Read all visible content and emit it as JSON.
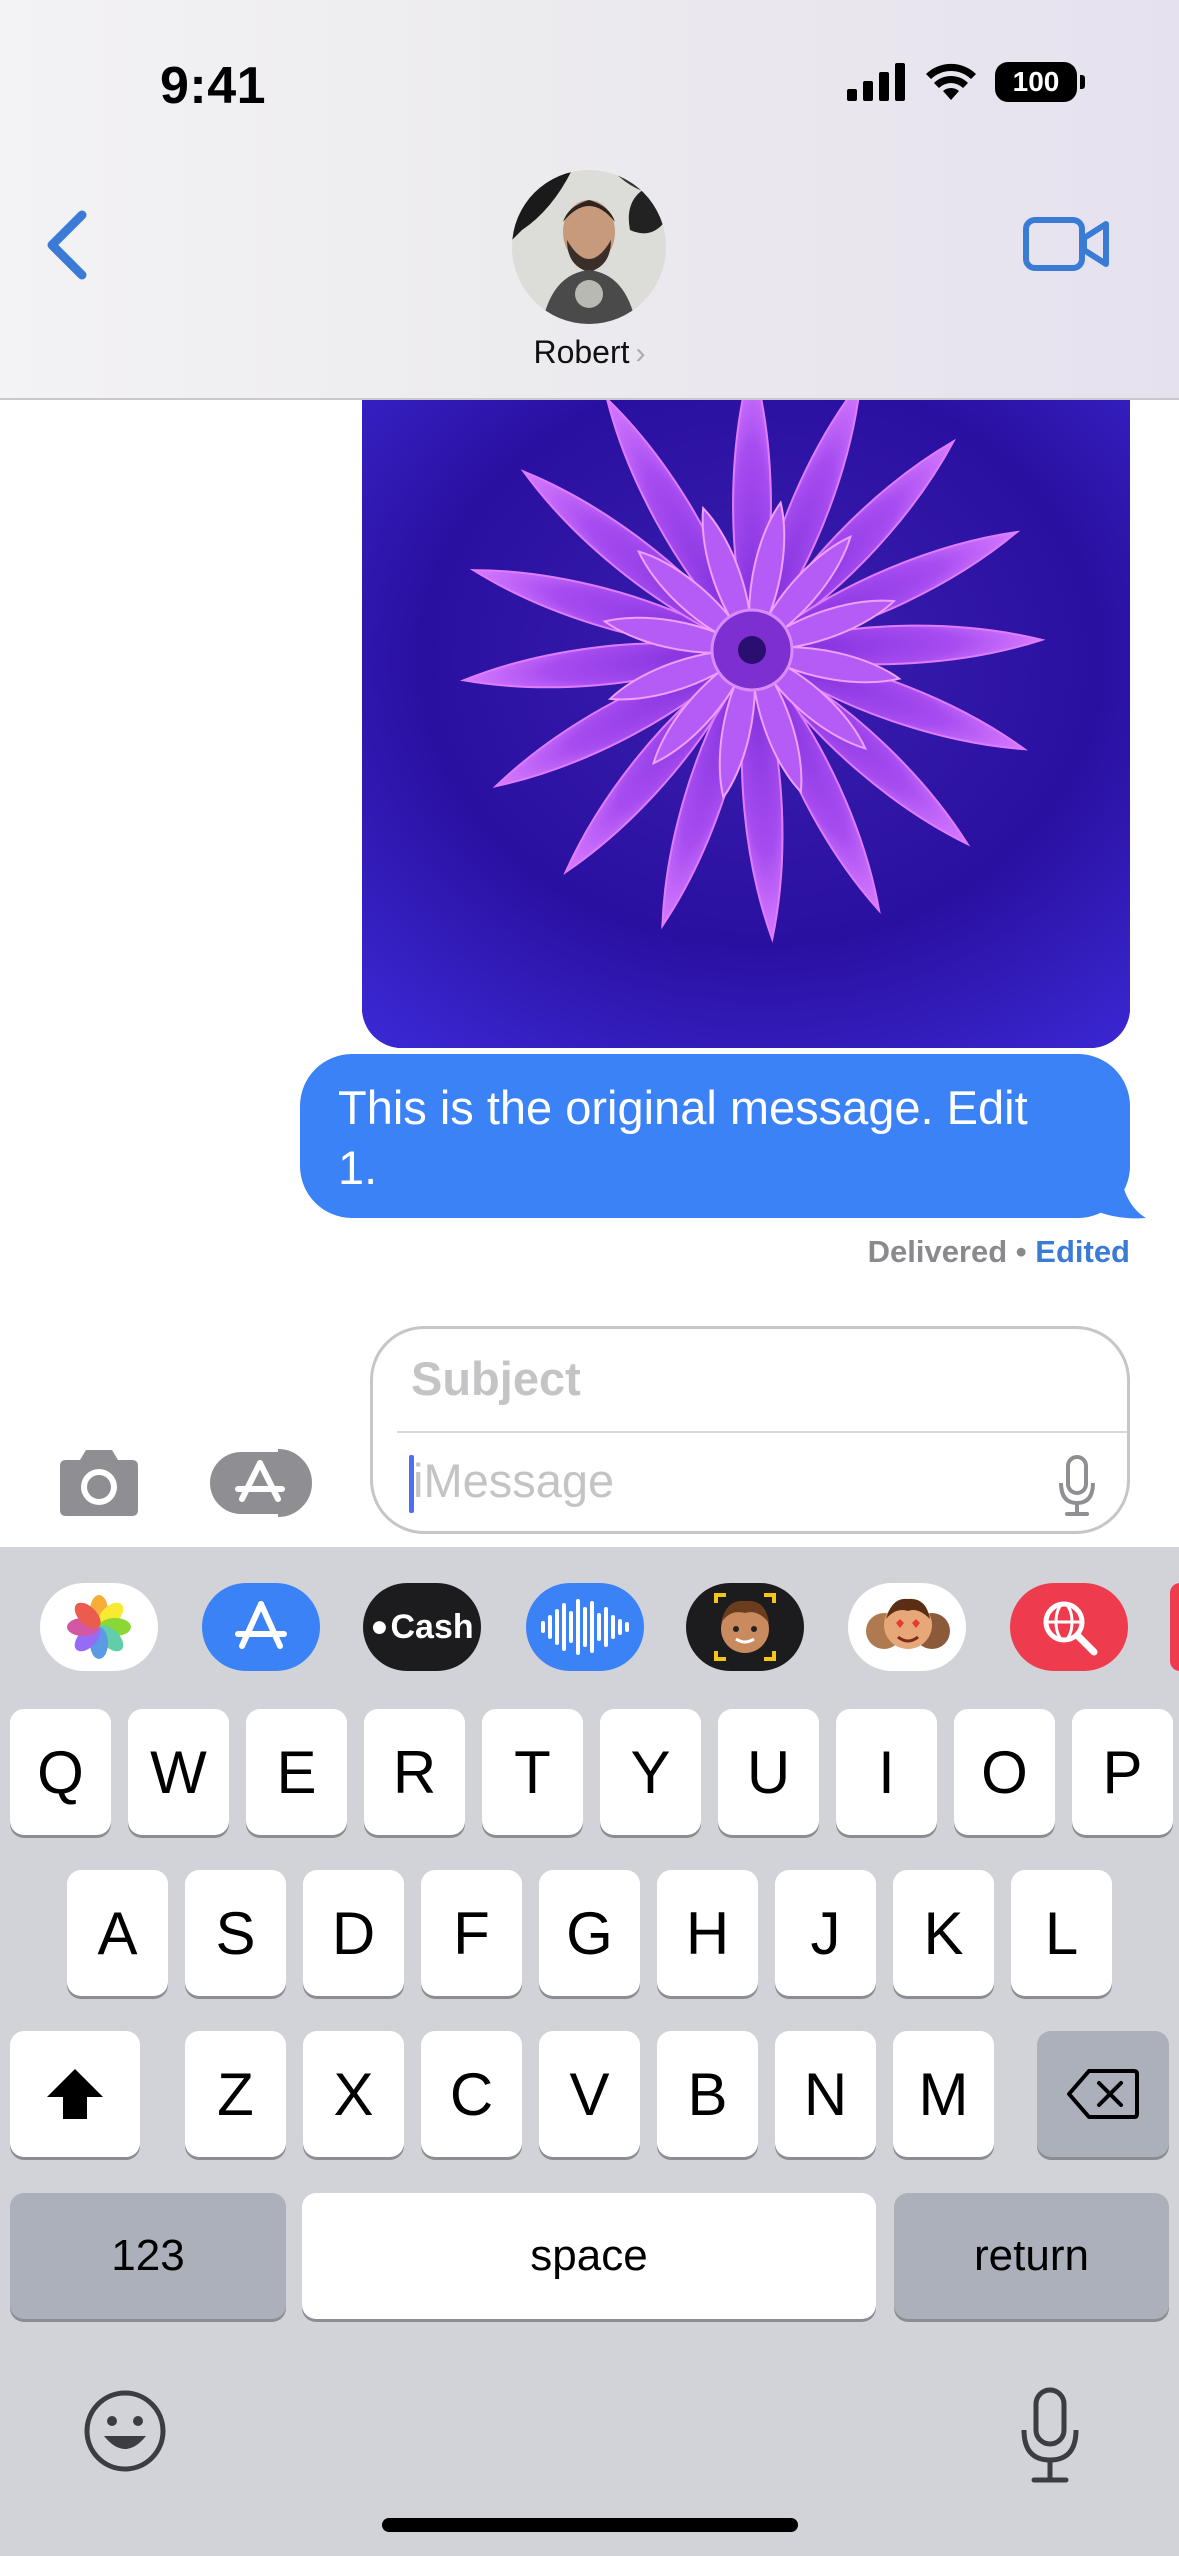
{
  "status_bar": {
    "time": "9:41",
    "battery": "100",
    "icons": [
      "cellular-signal-icon",
      "wifi-icon",
      "battery-icon"
    ]
  },
  "nav": {
    "back_icon": "chevron-left-icon",
    "contact_name": "Robert",
    "contact_chevron": "›",
    "video_icon": "video-camera-icon"
  },
  "messages": [
    {
      "type": "image",
      "from": "me",
      "description_icon": "flower-image"
    },
    {
      "type": "text",
      "from": "me",
      "line1": "This is the original message. Edit",
      "line2": "1."
    }
  ],
  "receipt": {
    "status": "Delivered",
    "separator": " • ",
    "edited": "Edited"
  },
  "compose": {
    "subject_placeholder": "Subject",
    "message_placeholder": "iMessage",
    "left_icons": [
      "camera-icon",
      "app-store-icon"
    ]
  },
  "app_drawer": [
    {
      "name": "photos-app-icon",
      "bg": "#ffffff"
    },
    {
      "name": "app-store-app-icon",
      "bg": "#3a82f6"
    },
    {
      "name": "apple-cash-app-icon",
      "bg": "#1c1c1e",
      "label": "Cash"
    },
    {
      "name": "audio-message-app-icon",
      "bg": "#3a82f6"
    },
    {
      "name": "memoji-camera-app-icon",
      "bg": "#1c1c1e"
    },
    {
      "name": "memoji-stickers-app-icon",
      "bg": "#ffffff"
    },
    {
      "name": "image-search-app-icon",
      "bg": "#ef3b4e"
    }
  ],
  "keyboard": {
    "row1": [
      "Q",
      "W",
      "E",
      "R",
      "T",
      "Y",
      "U",
      "I",
      "O",
      "P"
    ],
    "row2": [
      "A",
      "S",
      "D",
      "F",
      "G",
      "H",
      "J",
      "K",
      "L"
    ],
    "row3": [
      "Z",
      "X",
      "C",
      "V",
      "B",
      "N",
      "M"
    ],
    "numbers_label": "123",
    "space_label": "space",
    "return_label": "return"
  },
  "colors": {
    "accent": "#3a82f6",
    "edited_link": "#3a7bd5",
    "keyboard_bg": "#d1d3d9"
  }
}
